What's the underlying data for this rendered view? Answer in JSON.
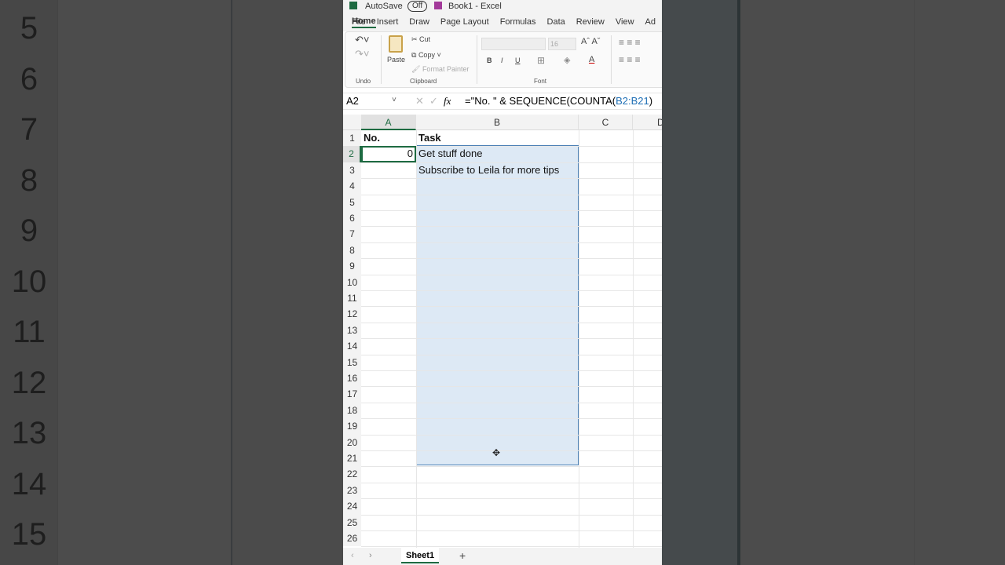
{
  "title_bar": {
    "autosave": "AutoSave",
    "toggle": "Off",
    "title": "Book1 - Excel"
  },
  "tabs": [
    "File",
    "Home",
    "Insert",
    "Draw",
    "Page Layout",
    "Formulas",
    "Data",
    "Review",
    "View",
    "Ad"
  ],
  "active_tab": "Home",
  "ribbon": {
    "undo_group": "Undo",
    "paste": "Paste",
    "cut": "Cut",
    "copy": "Copy",
    "format_painter": "Format Painter",
    "clipboard_group": "Clipboard",
    "font_size": "16",
    "bold": "B",
    "italic": "I",
    "underline": "U",
    "font_group": "Font"
  },
  "formula_bar": {
    "name_box": "A2",
    "fx": "fx",
    "formula_prefix": "=\"No. \" & SEQUENCE(COUNTA(",
    "formula_ref": "B2:B21",
    "formula_suffix": ")"
  },
  "columns": [
    "A",
    "B",
    "C",
    "D"
  ],
  "rows": [
    1,
    2,
    3,
    4,
    5,
    6,
    7,
    8,
    9,
    10,
    11,
    12,
    13,
    14,
    15,
    16,
    17,
    18,
    19,
    20,
    21,
    22,
    23,
    24,
    25,
    26
  ],
  "cells": {
    "A1": "No.",
    "B1": "Task",
    "A2": "0",
    "B2": "Get stuff done",
    "B3": "Subscribe to Leila for more tips"
  },
  "sheets": [
    "Sheet1"
  ],
  "add_sheet": "+",
  "background_rows": [
    5,
    6,
    7,
    8,
    9,
    10,
    11,
    12,
    13,
    14,
    15
  ],
  "colors": {
    "accent": "#1e6b42",
    "selection": "#dde9f5",
    "ref": "#1f6fb5"
  }
}
